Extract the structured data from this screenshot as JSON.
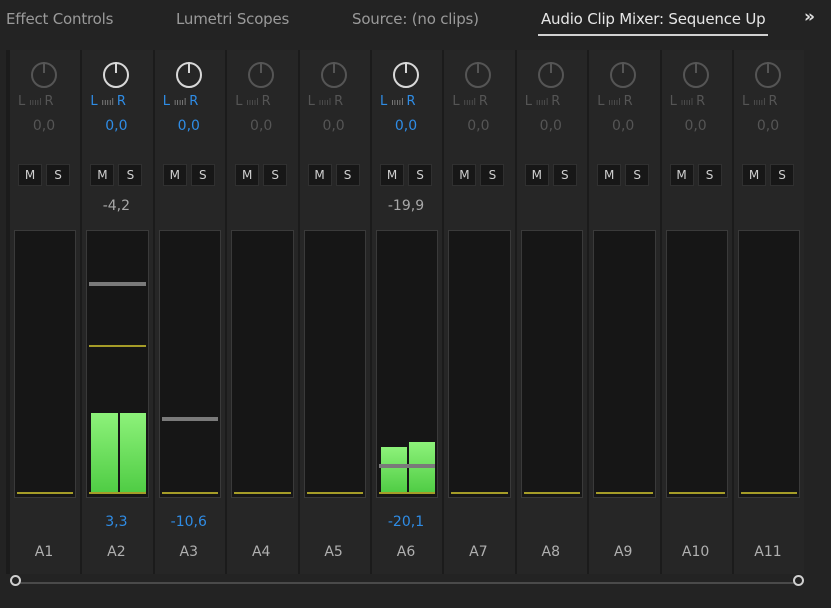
{
  "tabs": [
    {
      "label": "Effect Controls",
      "active": false
    },
    {
      "label": "Lumetri Scopes",
      "active": false
    },
    {
      "label": "Source: (no clips)",
      "active": false
    },
    {
      "label": "Audio Clip Mixer: Sequence Up",
      "active": true
    }
  ],
  "more_label": "»",
  "channels": [
    {
      "name": "A1",
      "active": false,
      "pan": "0,0",
      "peak": "",
      "volume": "",
      "left_level": 0,
      "right_level": 0,
      "fader_db": null
    },
    {
      "name": "A2",
      "active": true,
      "pan": "0,0",
      "peak": "-4,2",
      "volume": "3,3",
      "left_level": 0.3,
      "right_level": 0.3,
      "fader_db": 3.3
    },
    {
      "name": "A3",
      "active": true,
      "pan": "0,0",
      "peak": "",
      "volume": "-10,6",
      "left_level": 0,
      "right_level": 0,
      "fader_db": -10.6
    },
    {
      "name": "A4",
      "active": false,
      "pan": "0,0",
      "peak": "",
      "volume": "",
      "left_level": 0,
      "right_level": 0,
      "fader_db": null
    },
    {
      "name": "A5",
      "active": false,
      "pan": "0,0",
      "peak": "",
      "volume": "",
      "left_level": 0,
      "right_level": 0,
      "fader_db": null
    },
    {
      "name": "A6",
      "active": true,
      "pan": "0,0",
      "peak": "-19,9",
      "volume": "-20,1",
      "left_level": 0.17,
      "right_level": 0.19,
      "fader_db": -20.1
    },
    {
      "name": "A7",
      "active": false,
      "pan": "0,0",
      "peak": "",
      "volume": "",
      "left_level": 0,
      "right_level": 0,
      "fader_db": null
    },
    {
      "name": "A8",
      "active": false,
      "pan": "0,0",
      "peak": "",
      "volume": "",
      "left_level": 0,
      "right_level": 0,
      "fader_db": null
    },
    {
      "name": "A9",
      "active": false,
      "pan": "0,0",
      "peak": "",
      "volume": "",
      "left_level": 0,
      "right_level": 0,
      "fader_db": null
    },
    {
      "name": "A10",
      "active": false,
      "pan": "0,0",
      "peak": "",
      "volume": "",
      "left_level": 0,
      "right_level": 0,
      "fader_db": null
    },
    {
      "name": "A11",
      "active": false,
      "pan": "0,0",
      "peak": "",
      "volume": "",
      "left_level": 0,
      "right_level": 0,
      "fader_db": null
    }
  ],
  "labels": {
    "left": "L",
    "right": "R",
    "mute": "M",
    "solo": "S"
  },
  "icons": {
    "pan_knob": "pan-knob-icon",
    "scroll_left": "scroll-handle-icon",
    "scroll_right": "scroll-handle-icon"
  },
  "colors": {
    "accent_blue": "#2f8ce5",
    "meter_green": "#59d64c",
    "zero_line": "#a59c28"
  }
}
